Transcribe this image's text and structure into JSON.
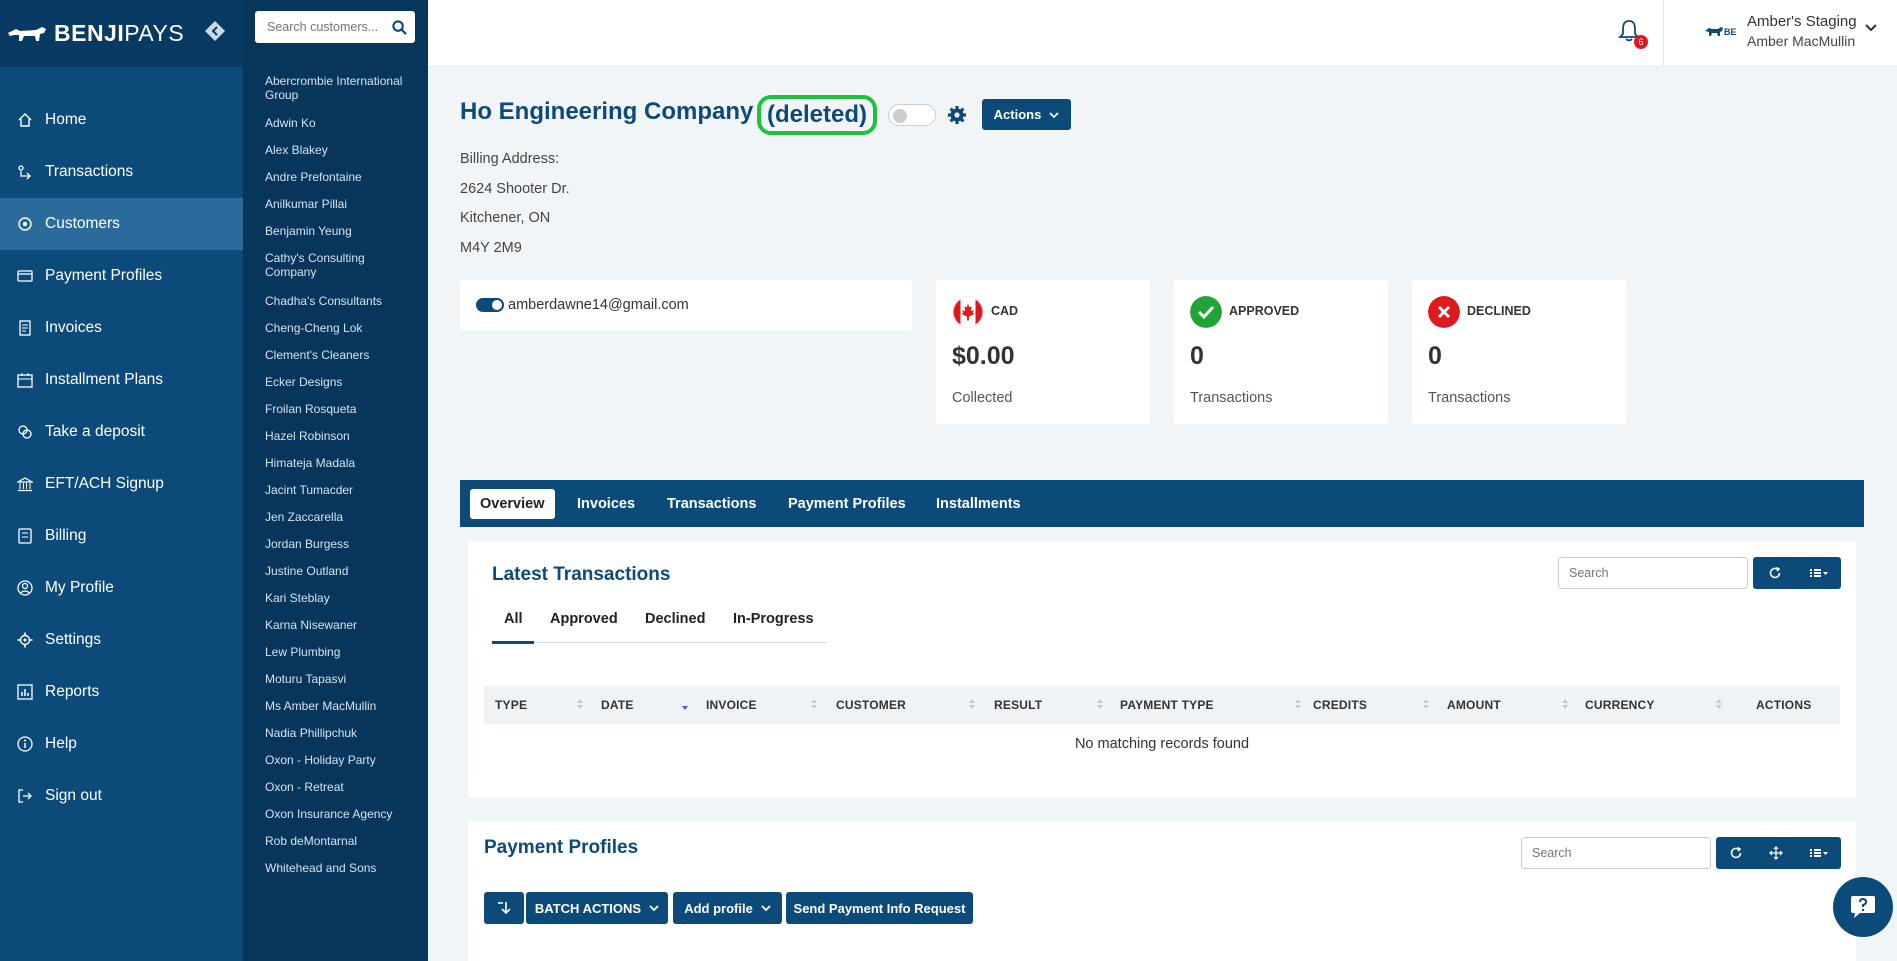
{
  "brand": {
    "name_bold": "BENJI",
    "name_light": "PAYS"
  },
  "nav": {
    "items": [
      {
        "label": "Home",
        "icon": "home-icon"
      },
      {
        "label": "Transactions",
        "icon": "transactions-icon"
      },
      {
        "label": "Customers",
        "icon": "customers-icon",
        "active": true
      },
      {
        "label": "Payment Profiles",
        "icon": "payment-profiles-icon"
      },
      {
        "label": "Invoices",
        "icon": "invoices-icon"
      },
      {
        "label": "Installment Plans",
        "icon": "calendar-icon"
      },
      {
        "label": "Take a deposit",
        "icon": "deposit-icon"
      },
      {
        "label": "EFT/ACH Signup",
        "icon": "bank-icon"
      },
      {
        "label": "Billing",
        "icon": "billing-icon"
      },
      {
        "label": "My Profile",
        "icon": "user-icon"
      },
      {
        "label": "Settings",
        "icon": "gear-icon"
      },
      {
        "label": "Reports",
        "icon": "reports-icon"
      },
      {
        "label": "Help",
        "icon": "help-icon"
      },
      {
        "label": "Sign out",
        "icon": "sign-out-icon"
      }
    ]
  },
  "customer_list": {
    "search_placeholder": "Search customers...",
    "items": [
      "Abercrombie International Group",
      "Adwin Ko",
      "Alex Blakey",
      "Andre Prefontaine",
      "Anilkumar Pillai",
      "Benjamin Yeung",
      "Cathy's Consulting Company",
      "Chadha's Consultants",
      "Cheng-Cheng Lok",
      "Clement's Cleaners",
      "Ecker Designs",
      "Froilan Rosqueta",
      "Hazel Robinson",
      "Himateja Madala",
      "Jacint Tumacder",
      "Jen Zaccarella",
      "Jordan Burgess",
      "Justine Outland",
      "Kari Steblay",
      "Karna Nisewaner",
      "Lew Plumbing",
      "Moturu Tapasvi",
      "Ms Amber MacMullin",
      "Nadia Phillipchuk",
      "Oxon - Holiday Party",
      "Oxon - Retreat",
      "Oxon Insurance Agency",
      "Rob deMontarnal",
      "Whitehead and Sons"
    ]
  },
  "topbar": {
    "notification_count": "6",
    "account_name": "Amber's Staging",
    "account_user": "Amber MacMullin"
  },
  "customer": {
    "name": "Ho Engineering Company",
    "status": "(deleted)",
    "actions_label": "Actions",
    "billing_label": "Billing Address:",
    "address_line1": "2624 Shooter Dr.",
    "address_line2": "Kitchener, ON",
    "postal": "M4Y 2M9",
    "email": "amberdawne14@gmail.com"
  },
  "stats": [
    {
      "label": "CAD",
      "value": "$0.00",
      "sub": "Collected",
      "icon": "canada-flag-icon",
      "color": "#ffffff"
    },
    {
      "label": "APPROVED",
      "value": "0",
      "sub": "Transactions",
      "icon": "check-icon",
      "color": "#21a336"
    },
    {
      "label": "DECLINED",
      "value": "0",
      "sub": "Transactions",
      "icon": "close-icon",
      "color": "#e0191f"
    }
  ],
  "tabs": [
    "Overview",
    "Invoices",
    "Transactions",
    "Payment Profiles",
    "Installments"
  ],
  "latest_transactions": {
    "title": "Latest Transactions",
    "search_placeholder": "Search",
    "subtabs": [
      "All",
      "Approved",
      "Declined",
      "In-Progress"
    ],
    "columns": [
      "TYPE",
      "DATE",
      "INVOICE",
      "CUSTOMER",
      "RESULT",
      "PAYMENT TYPE",
      "CREDITS",
      "AMOUNT",
      "CURRENCY",
      "ACTIONS"
    ],
    "empty_text": "No matching records found"
  },
  "payment_profiles": {
    "title": "Payment Profiles",
    "search_placeholder": "Search",
    "batch_label": "BATCH ACTIONS",
    "add_label": "Add profile",
    "request_label": "Send Payment Info Request"
  },
  "colors": {
    "primary": "#0c4a7a",
    "highlight": "#1dc43a"
  }
}
